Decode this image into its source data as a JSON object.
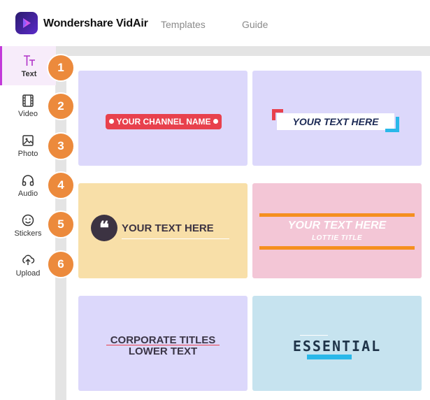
{
  "header": {
    "brand": "Wondershare VidAir",
    "nav": [
      {
        "label": "Templates"
      },
      {
        "label": "Guide"
      }
    ]
  },
  "sidebar": {
    "items": [
      {
        "label": "Text",
        "icon": "text-icon",
        "badge": "1",
        "active": true
      },
      {
        "label": "Video",
        "icon": "film-icon",
        "badge": "2"
      },
      {
        "label": "Photo",
        "icon": "image-icon",
        "badge": "3"
      },
      {
        "label": "Audio",
        "icon": "headphones-icon",
        "badge": "4"
      },
      {
        "label": "Stickers",
        "icon": "smiley-icon",
        "badge": "5"
      },
      {
        "label": "Upload",
        "icon": "upload-icon",
        "badge": "6"
      }
    ]
  },
  "templates": [
    {
      "line1": "YOUR CHANNEL NAME"
    },
    {
      "line1": "YOUR TEXT HERE"
    },
    {
      "line1": "YOUR TEXT HERE",
      "quote": "❝"
    },
    {
      "line1": "YOUR TEXT HERE",
      "line2": "LOTTIE TITLE"
    },
    {
      "line1": "CORPORATE TITLES",
      "line2": "LOWER TEXT"
    },
    {
      "line1": "ESSENTIAL"
    }
  ],
  "colors": {
    "accent": "#c239d9",
    "badge": "#ec8a3c",
    "red": "#e8414d",
    "blue": "#2ab8e9",
    "orange": "#f58f1f"
  }
}
